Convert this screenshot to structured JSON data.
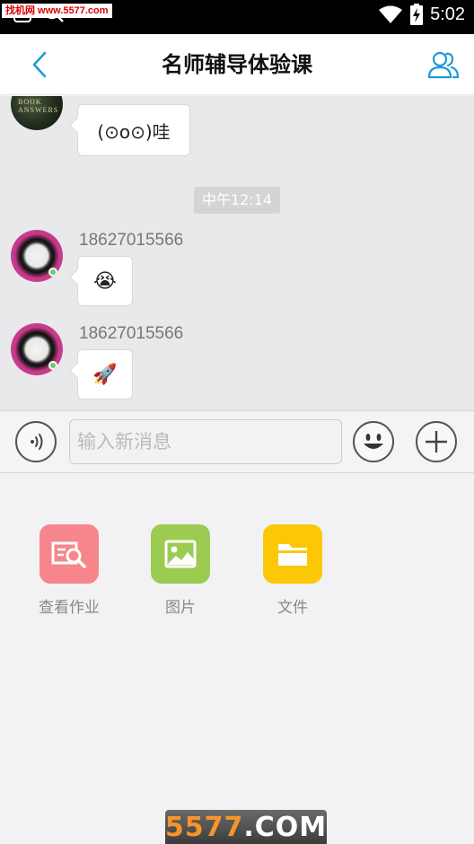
{
  "status_bar": {
    "watermark": "找机网 www.5577.com",
    "time": "5:02"
  },
  "header": {
    "title": "名师辅导体验课"
  },
  "chat": {
    "messages": [
      {
        "sender": "",
        "text": "(⊙o⊙)哇"
      },
      {
        "sender": "18627015566",
        "text": "😭"
      },
      {
        "sender": "18627015566",
        "text": "🚀"
      }
    ],
    "time_divider": "中午12:14",
    "book_avatar_text": "BOOK ANSWERS"
  },
  "input_bar": {
    "placeholder": "输入新消息"
  },
  "tools": [
    {
      "label": "查看作业",
      "color": "#f6868b",
      "icon": "search-document-icon"
    },
    {
      "label": "图片",
      "color": "#9ccb52",
      "icon": "image-icon"
    },
    {
      "label": "文件",
      "color": "#fcc707",
      "icon": "folder-icon"
    }
  ],
  "bottom_watermark": {
    "num": "5577",
    "com": ".COM"
  },
  "colors": {
    "accent": "#1a9bd7"
  }
}
